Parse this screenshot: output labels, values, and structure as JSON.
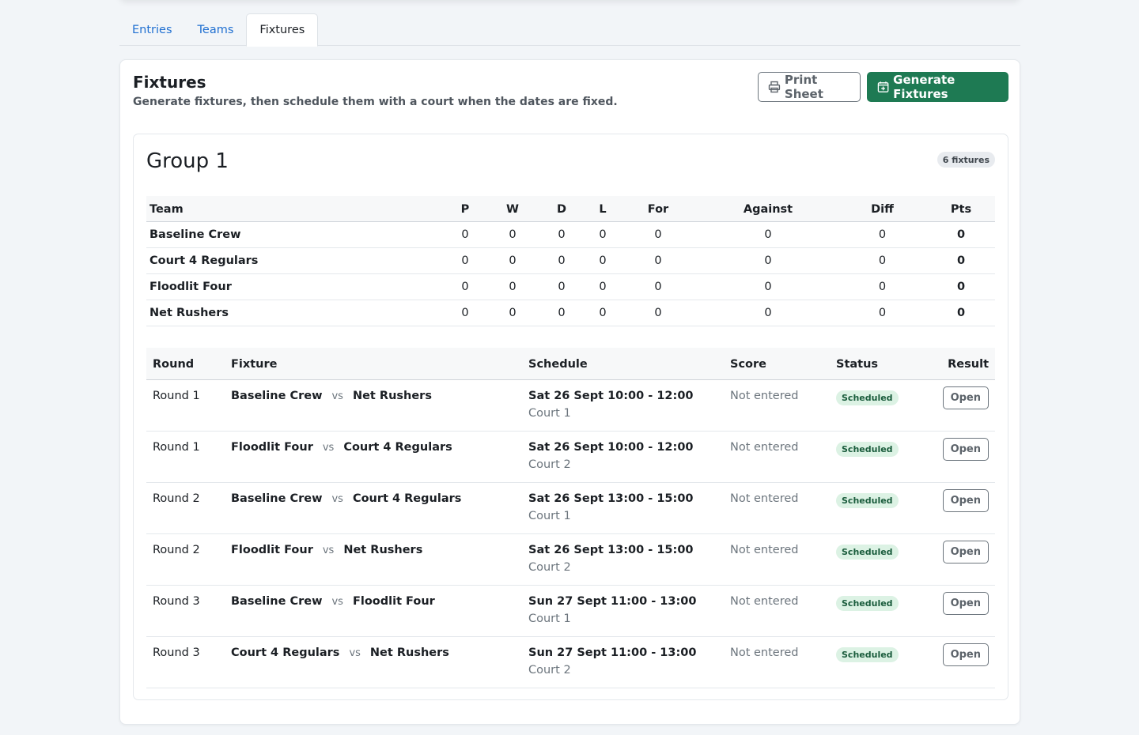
{
  "tabs": [
    {
      "label": "Entries",
      "active": false
    },
    {
      "label": "Teams",
      "active": false
    },
    {
      "label": "Fixtures",
      "active": true
    }
  ],
  "card": {
    "title": "Fixtures",
    "subtitle": "Generate fixtures, then schedule them with a court when the dates are fixed.",
    "print_label": "Print Sheet",
    "generate_label": "Generate Fixtures"
  },
  "colors": {
    "primary": "#1e7a53",
    "link": "#1f6fd1",
    "status_bg": "#dcf2e4"
  },
  "group": {
    "title": "Group 1",
    "fixture_count": "6 fixtures",
    "standings": {
      "headers": [
        "Team",
        "P",
        "W",
        "D",
        "L",
        "For",
        "Against",
        "Diff",
        "Pts"
      ],
      "rows": [
        [
          "Baseline Crew",
          "0",
          "0",
          "0",
          "0",
          "0",
          "0",
          "0",
          "0"
        ],
        [
          "Court 4 Regulars",
          "0",
          "0",
          "0",
          "0",
          "0",
          "0",
          "0",
          "0"
        ],
        [
          "Floodlit Four",
          "0",
          "0",
          "0",
          "0",
          "0",
          "0",
          "0",
          "0"
        ],
        [
          "Net Rushers",
          "0",
          "0",
          "0",
          "0",
          "0",
          "0",
          "0",
          "0"
        ]
      ]
    },
    "fixtures": {
      "headers": [
        "Round",
        "Fixture",
        "Schedule",
        "Score",
        "Status",
        "Result"
      ],
      "vs_label": "vs",
      "rows": [
        {
          "round": "Round 1",
          "home": "Baseline Crew",
          "away": "Net Rushers",
          "schedule": "Sat 26 Sept 10:00 - 12:00",
          "court": "Court 1",
          "score": "Not entered",
          "status": "Scheduled",
          "result": "Open"
        },
        {
          "round": "Round 1",
          "home": "Floodlit Four",
          "away": "Court 4 Regulars",
          "schedule": "Sat 26 Sept 10:00 - 12:00",
          "court": "Court 2",
          "score": "Not entered",
          "status": "Scheduled",
          "result": "Open"
        },
        {
          "round": "Round 2",
          "home": "Baseline Crew",
          "away": "Court 4 Regulars",
          "schedule": "Sat 26 Sept 13:00 - 15:00",
          "court": "Court 1",
          "score": "Not entered",
          "status": "Scheduled",
          "result": "Open"
        },
        {
          "round": "Round 2",
          "home": "Floodlit Four",
          "away": "Net Rushers",
          "schedule": "Sat 26 Sept 13:00 - 15:00",
          "court": "Court 2",
          "score": "Not entered",
          "status": "Scheduled",
          "result": "Open"
        },
        {
          "round": "Round 3",
          "home": "Baseline Crew",
          "away": "Floodlit Four",
          "schedule": "Sun 27 Sept 11:00 - 13:00",
          "court": "Court 1",
          "score": "Not entered",
          "status": "Scheduled",
          "result": "Open"
        },
        {
          "round": "Round 3",
          "home": "Court 4 Regulars",
          "away": "Net Rushers",
          "schedule": "Sun 27 Sept 11:00 - 13:00",
          "court": "Court 2",
          "score": "Not entered",
          "status": "Scheduled",
          "result": "Open"
        }
      ]
    }
  }
}
